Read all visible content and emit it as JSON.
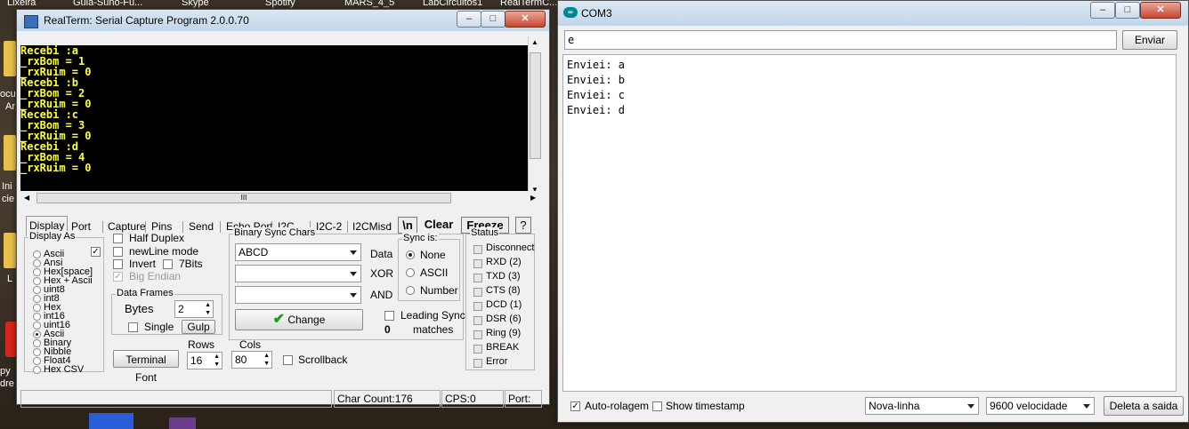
{
  "desktop": {
    "top_labels": [
      "Lixeira",
      "Guia-Suno-Fu...",
      "Skype",
      "Spotify",
      "MARS_4_5",
      "LabCircuitos1",
      "RealTermC..."
    ],
    "left_labels": [
      "ocu",
      "Ar",
      "Ini",
      "cie",
      "L",
      "py",
      "dre"
    ]
  },
  "realterm": {
    "title": "RealTerm: Serial Capture Program 2.0.0.70",
    "terminal_lines": [
      "Recebi :a",
      "_rxBom = 1",
      "_rxRuim = 0",
      "Recebi :b",
      "_rxBom = 2",
      "_rxRuim = 0",
      "Recebi :c",
      "_rxBom = 3",
      "_rxRuim = 0",
      "Recebi :d",
      "_rxBom = 4",
      "_rxRuim = 0"
    ],
    "hscroll_grip": "III",
    "tabs": [
      "Display",
      "Port",
      "Capture",
      "Pins",
      "Send",
      "Echo Port",
      "I2C",
      "I2C-2",
      "I2CMisc",
      "I"
    ],
    "buttons": {
      "newline": "\\n",
      "clear": "Clear",
      "freeze": "Freeze",
      "help": "?"
    },
    "display_as": {
      "title": "Display As",
      "items": [
        "Ascii",
        "Ansi",
        "Hex[space]",
        "Hex + Ascii",
        "uint8",
        "int8",
        "Hex",
        "int16",
        "uint16",
        "Ascii",
        "Binary",
        "Nibble",
        "Float4",
        "Hex CSV"
      ],
      "selected_index": 9
    },
    "options": {
      "half_duplex": "Half Duplex",
      "newline_mode": "newLine mode",
      "invert": "Invert",
      "seven_bits": "7Bits",
      "big_endian": "Big Endian"
    },
    "data_frames": {
      "title": "Data Frames",
      "bytes_label": "Bytes",
      "bytes_value": "2",
      "single": "Single",
      "gulp": "Gulp"
    },
    "binary_sync": {
      "title": "Binary Sync Chars",
      "data_value": "ABCD",
      "data_label": "Data",
      "xor_label": "XOR",
      "and_label": "AND",
      "change": "Change",
      "leading_sync": "Leading Sync",
      "matches": "matches",
      "count": "0"
    },
    "sync_is": {
      "title": "Sync is:",
      "options": [
        "None",
        "ASCII",
        "Number"
      ],
      "selected_index": 0
    },
    "terminal": {
      "font_button": "Terminal Font",
      "rows_label": "Rows",
      "rows_value": "16",
      "cols_label": "Cols",
      "cols_value": "80",
      "scrollback": "Scrollback"
    },
    "status": {
      "title": "Status",
      "items": [
        "Disconnect",
        "RXD (2)",
        "TXD (3)",
        "CTS (8)",
        "DCD (1)",
        "DSR (6)",
        "Ring (9)",
        "BREAK",
        "Error"
      ]
    },
    "statusbar": {
      "char_count": "Char Count:176",
      "cps": "CPS:0",
      "port": "Port:"
    }
  },
  "com3": {
    "title": "COM3",
    "input_value": "e",
    "send_button": "Enviar",
    "output_lines": [
      "Enviei: a",
      "Enviei: b",
      "Enviei: c",
      "Enviei: d"
    ],
    "autoscroll_label": "Auto-rolagem",
    "autoscroll_checked": true,
    "timestamp_label": "Show timestamp",
    "line_ending": "Nova-linha",
    "baud": "9600 velocidade",
    "clear_button": "Deleta a saida"
  }
}
